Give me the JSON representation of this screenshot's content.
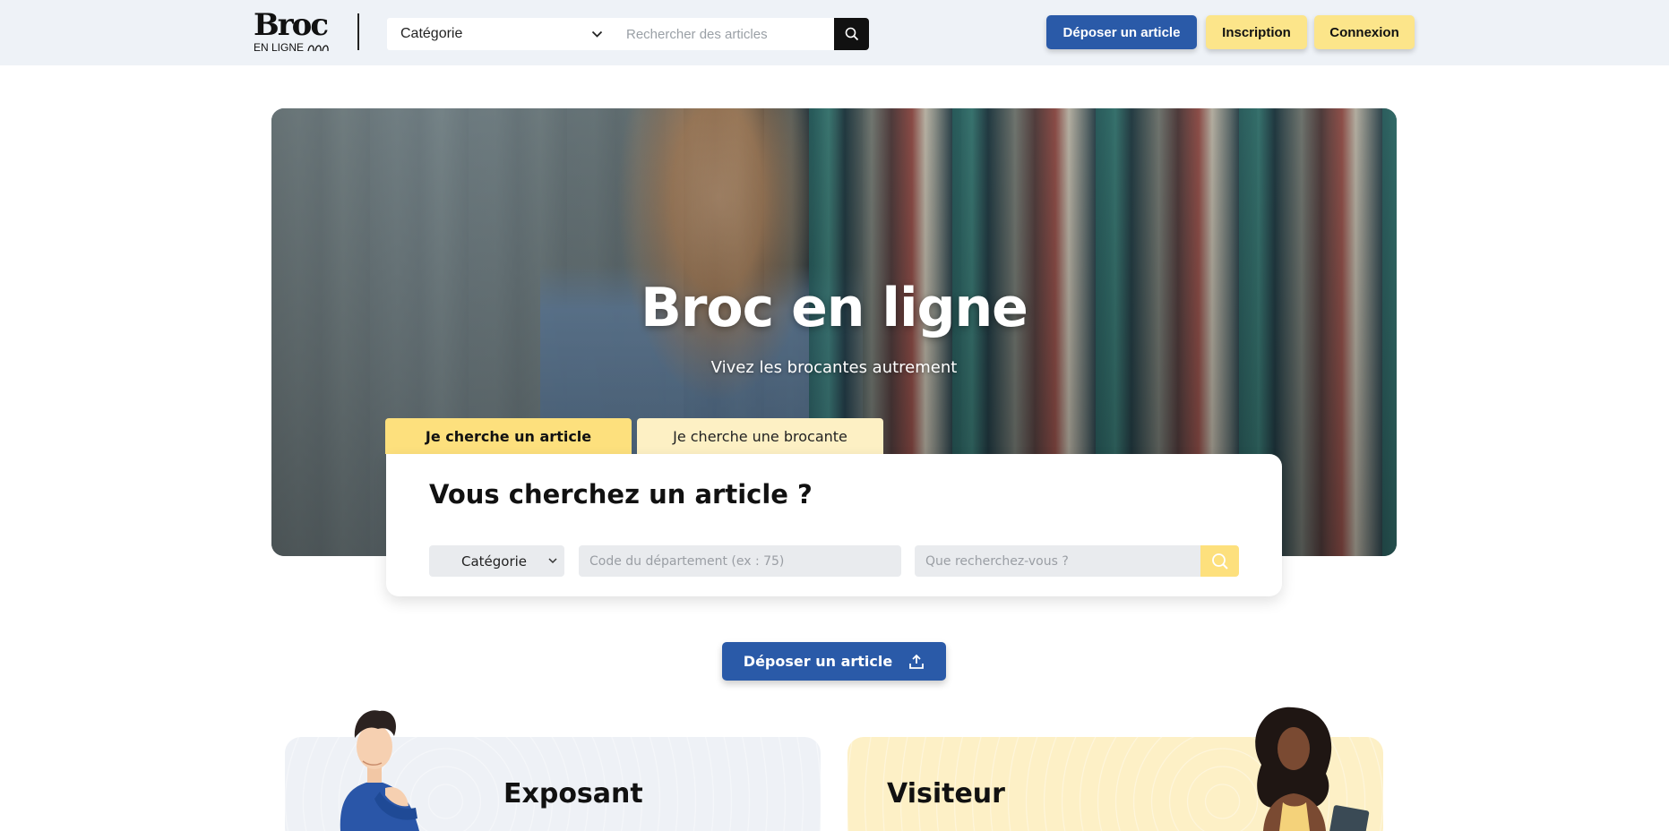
{
  "header": {
    "logo_main": "Broc",
    "logo_sub": "EN LIGNE",
    "category_label": "Catégorie",
    "search_placeholder": "Rechercher des articles",
    "buttons": {
      "deposit": "Déposer un article",
      "signup": "Inscription",
      "login": "Connexion"
    }
  },
  "hero": {
    "title": "Broc en ligne",
    "subtitle": "Vivez les brocantes autrement"
  },
  "search_tabs": {
    "active": "Je cherche un article",
    "inactive": "Je cherche une brocante"
  },
  "search_card": {
    "title": "Vous cherchez un article ?",
    "category_label": "Catégorie",
    "department_placeholder": "Code du département (ex : 75)",
    "query_placeholder": "Que recherchez-vous ?"
  },
  "cta": {
    "label": "Déposer un article"
  },
  "profiles": {
    "exhibitor_title": "Exposant",
    "visitor_title": "Visiteur"
  },
  "colors": {
    "primary_blue": "#2a5aa8",
    "accent_yellow": "#fde07d",
    "header_bg": "#eef2f7",
    "exhibitor_card_bg": "#eef1f6",
    "visitor_card_bg": "#fdf0c6"
  },
  "icons": {
    "header_search": "search-icon",
    "category_dropdown": "chevron-down-icon",
    "query_search": "search-icon",
    "cta_upload": "upload-icon"
  }
}
